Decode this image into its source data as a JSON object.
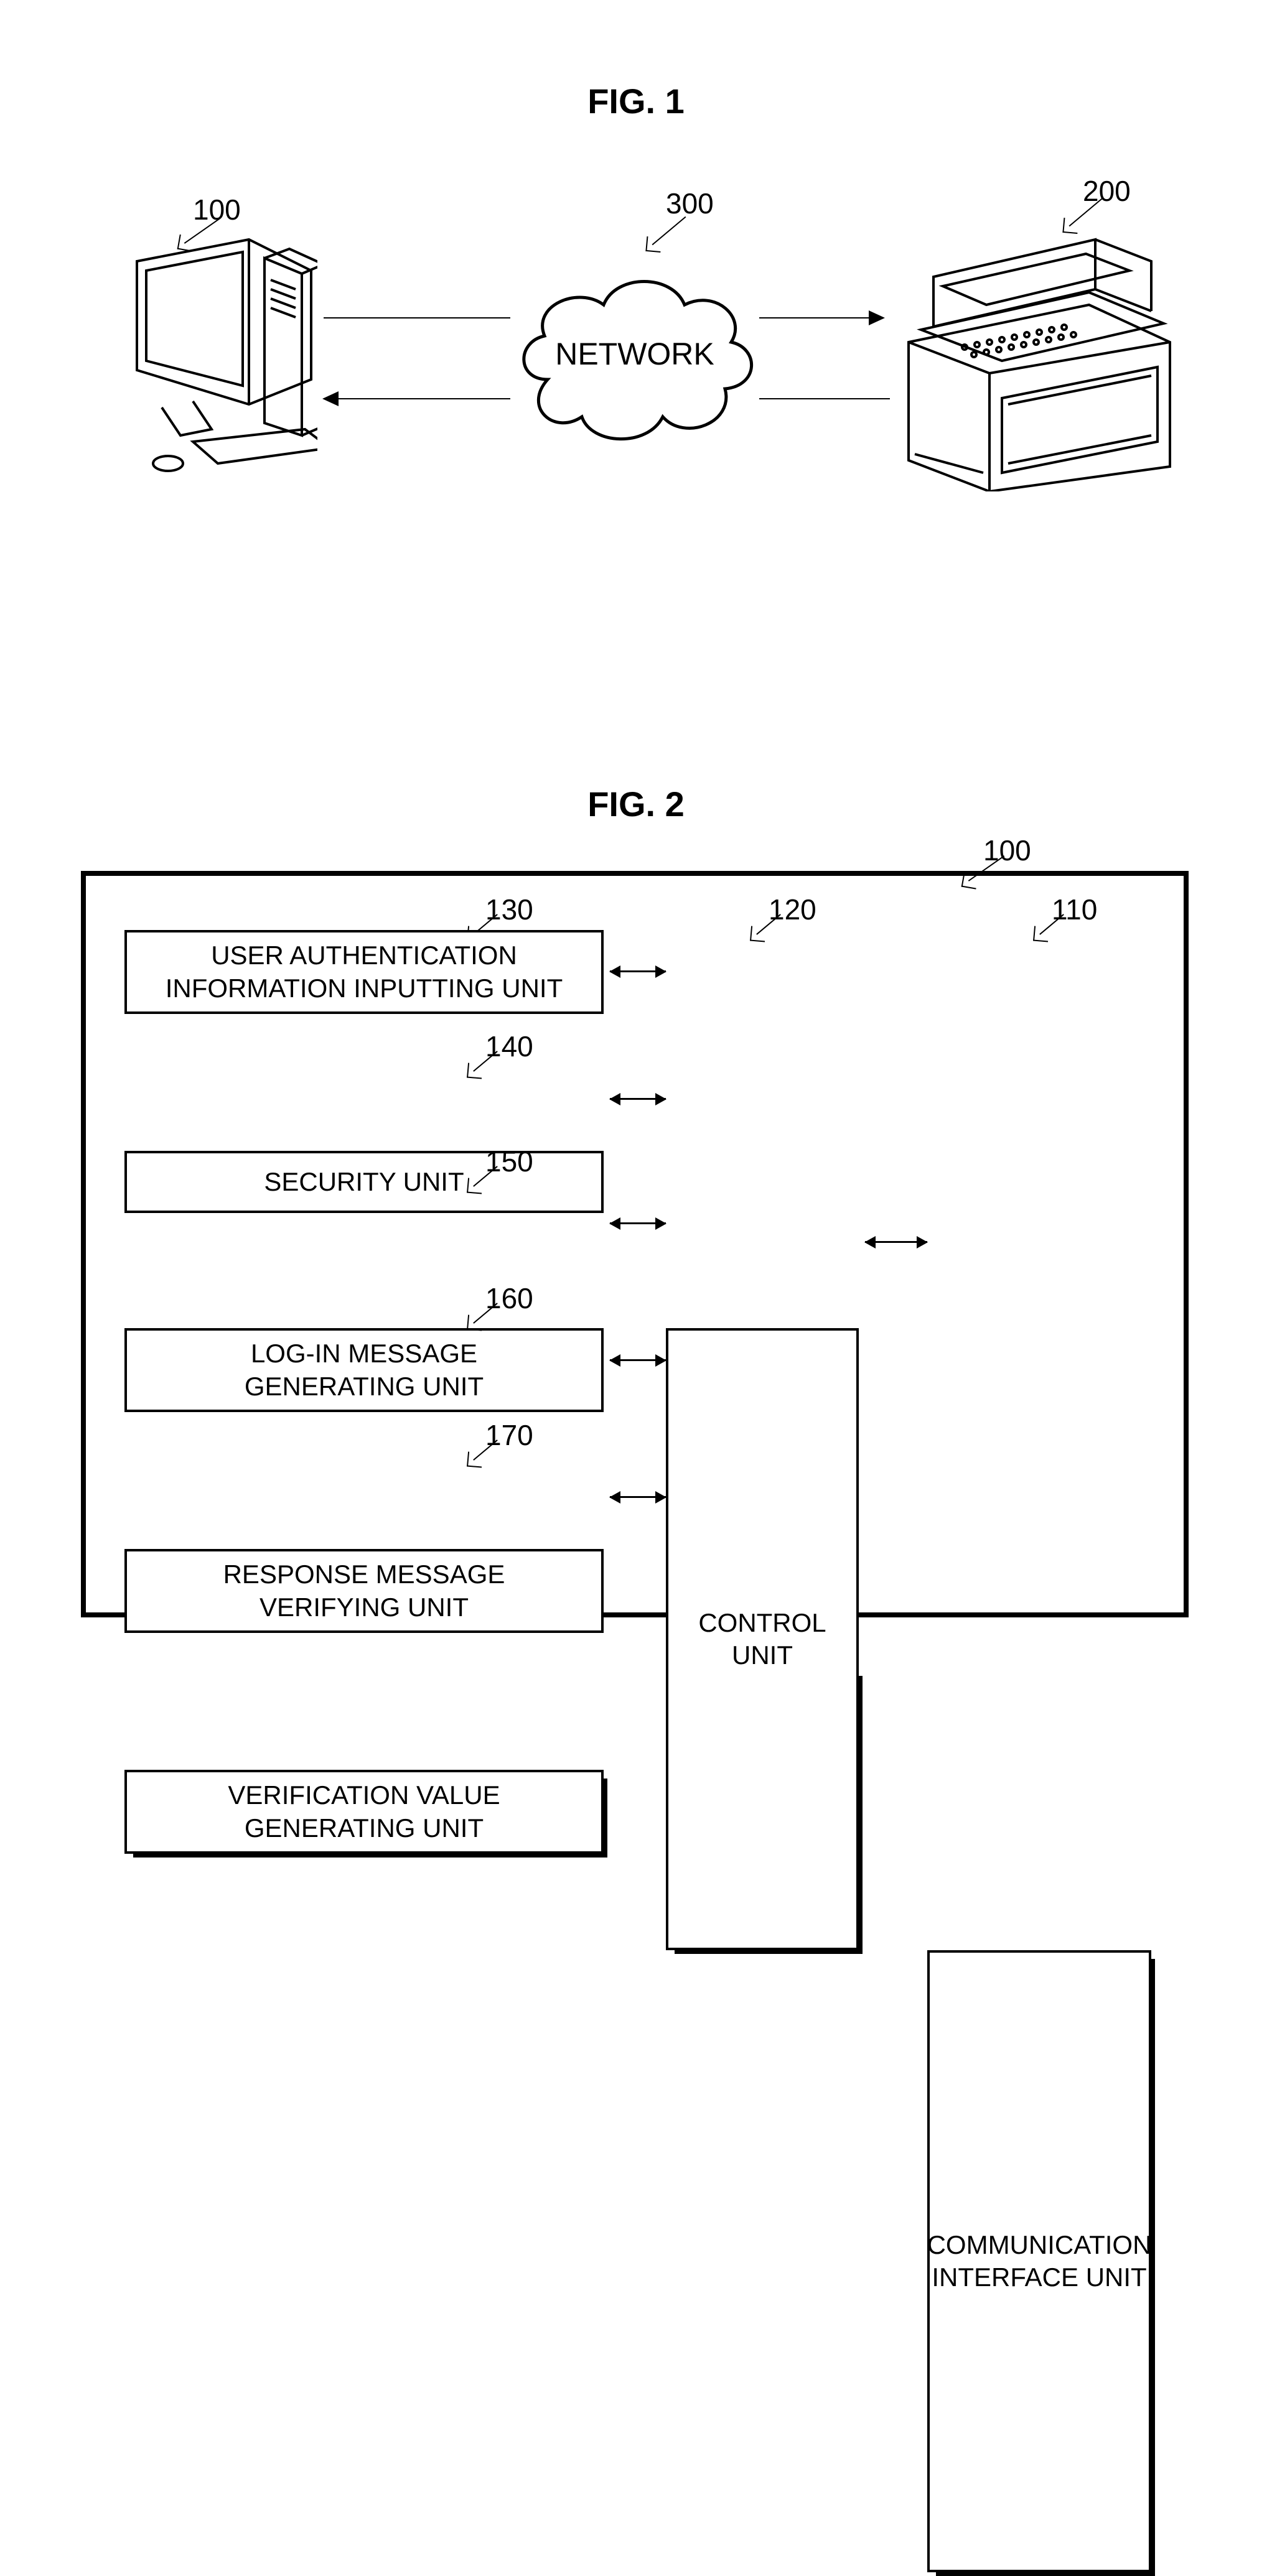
{
  "fig1": {
    "title": "FIG.  1",
    "refs": {
      "host": "100",
      "network": "300",
      "printer": "200"
    },
    "network_label": "NETWORK"
  },
  "fig2": {
    "title": "FIG.  2",
    "refs": {
      "host": "100",
      "comm_if": "110",
      "control": "120",
      "auth_input": "130",
      "security": "140",
      "login_msg": "150",
      "resp_verify": "160",
      "ver_val": "170"
    },
    "boxes": {
      "auth_input": "USER AUTHENTICATION\nINFORMATION INPUTTING UNIT",
      "security": "SECURITY UNIT",
      "login_msg": "LOG-IN MESSAGE\nGENERATING UNIT",
      "resp_verify": "RESPONSE MESSAGE\nVERIFYING UNIT",
      "ver_val": "VERIFICATION VALUE\nGENERATING UNIT",
      "control": "CONTROL\nUNIT",
      "comm_if": "COMMUNICATION\nINTERFACE UNIT"
    }
  }
}
